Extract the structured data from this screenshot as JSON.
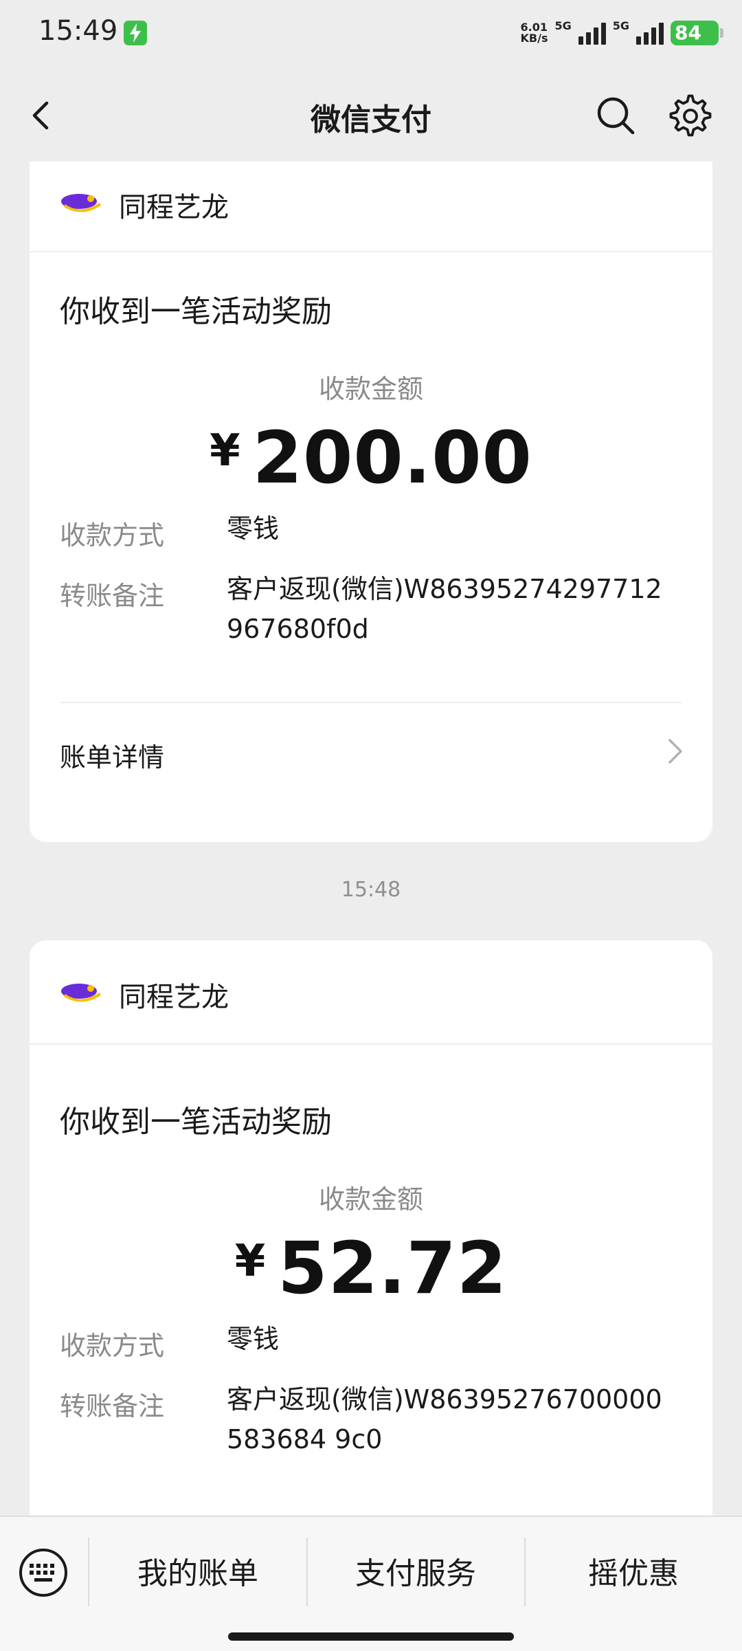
{
  "status_bar": {
    "time": "15:49",
    "net_speed_value": "6.01",
    "net_speed_unit": "KB/s",
    "sim1": "5G",
    "sim2": "5G",
    "battery": "84"
  },
  "nav": {
    "title": "微信支付"
  },
  "messages": [
    {
      "merchant": "同程艺龙",
      "title": "你收到一笔活动奖励",
      "amount_label": "收款金额",
      "currency": "¥",
      "amount": "200.00",
      "method_label": "收款方式",
      "method_value": "零钱",
      "note_label": "转账备注",
      "note_value": "客户返现(微信)W86395274297712967680f0d",
      "detail_link": "账单详情"
    },
    {
      "merchant": "同程艺龙",
      "title": "你收到一笔活动奖励",
      "amount_label": "收款金额",
      "currency": "¥",
      "amount": "52.72",
      "method_label": "收款方式",
      "method_value": "零钱",
      "note_label": "转账备注",
      "note_value": "客户返现(微信)W86395276700000583684 9c0"
    }
  ],
  "timestamp": "15:48",
  "bottom_menu": {
    "items": [
      "我的账单",
      "支付服务",
      "摇优惠"
    ]
  },
  "colors": {
    "background": "#ededed",
    "card": "#ffffff",
    "accent_green": "#3dc04a",
    "logo_purple": "#6a2bd9",
    "logo_yellow": "#f5c000"
  }
}
